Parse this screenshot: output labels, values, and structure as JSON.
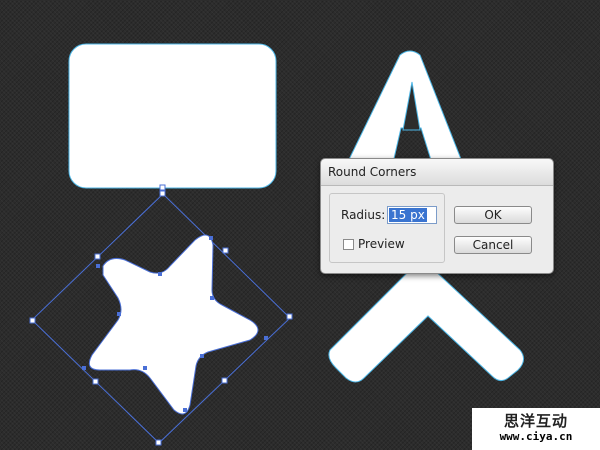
{
  "canvas": {
    "background": "#2c2c2c",
    "shape_fill": "#ffffff",
    "shape_stroke": "#4cb6e6",
    "selection_color": "#4a6fd6"
  },
  "dialog": {
    "title": "Round Corners",
    "radius_label": "Radius:",
    "radius_value": "15 px",
    "preview_label": "Preview",
    "preview_checked": false,
    "ok_label": "OK",
    "cancel_label": "Cancel"
  },
  "watermark": {
    "title": "思洋互动",
    "url": "www.ciya.cn"
  }
}
